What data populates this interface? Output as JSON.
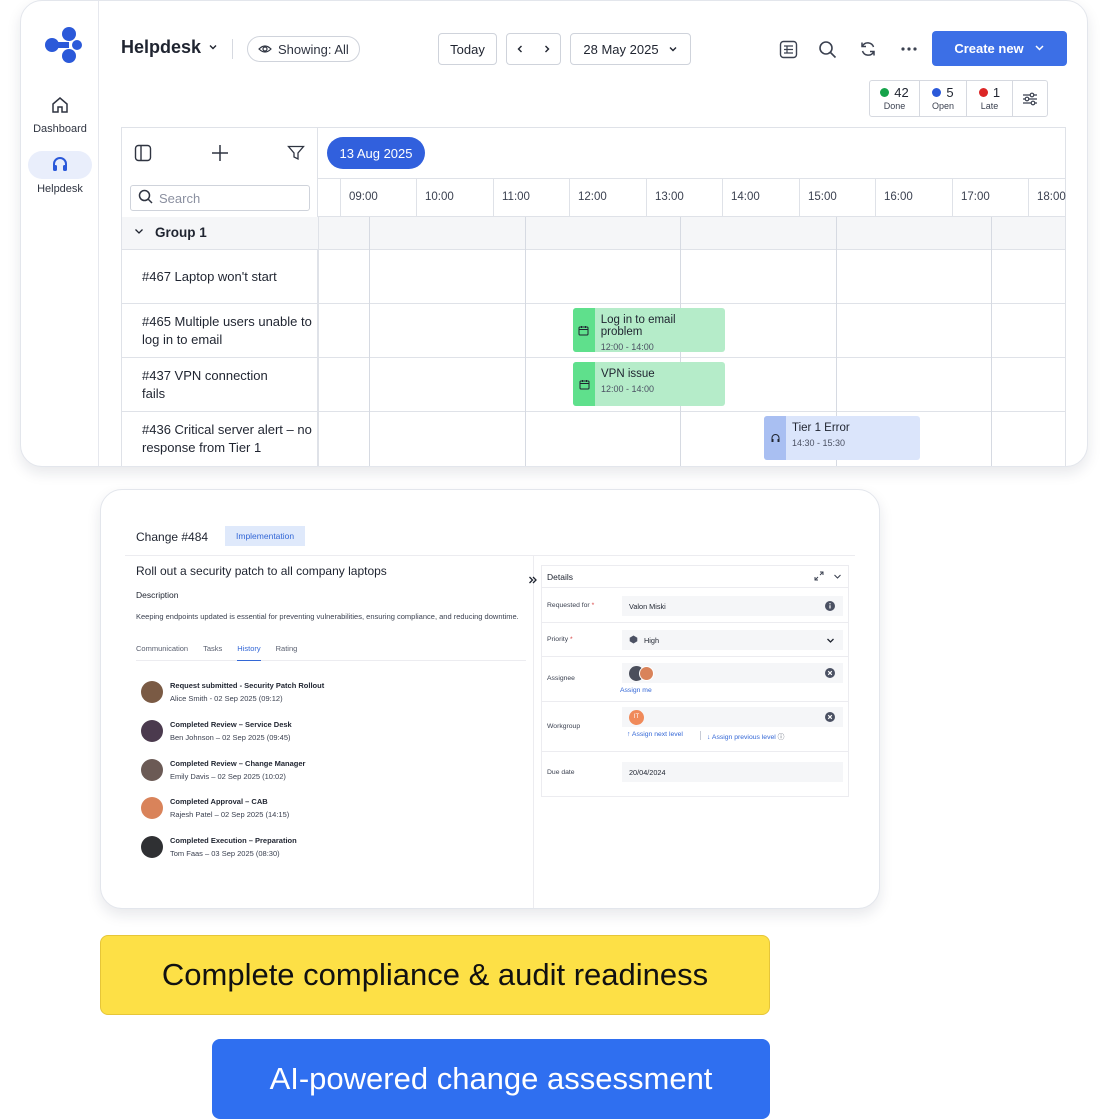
{
  "sidebar": {
    "items": [
      {
        "label": "Dashboard",
        "icon": "home-icon"
      },
      {
        "label": "Helpdesk",
        "icon": "headset-icon"
      }
    ]
  },
  "topbar": {
    "title": "Helpdesk",
    "showing": "Showing: All",
    "today": "Today",
    "date": "28 May 2025",
    "create": "Create new"
  },
  "stats": [
    {
      "value": "42",
      "label": "Done",
      "color": "#16a34a"
    },
    {
      "value": "5",
      "label": "Open",
      "color": "#2b59d9"
    },
    {
      "value": "1",
      "label": "Late",
      "color": "#dc2626"
    }
  ],
  "scheduler": {
    "date_bubble": "13 Aug 2025",
    "search_placeholder": "Search",
    "hours": [
      "09:00",
      "10:00",
      "11:00",
      "12:00",
      "13:00",
      "14:00",
      "15:00",
      "16:00",
      "17:00",
      "18:00"
    ],
    "group": "Group 1",
    "rows": [
      {
        "label": "#467 Laptop won't start"
      },
      {
        "label": "#465 Multiple users unable to log in to email"
      },
      {
        "label": "#437 VPN connection fails"
      },
      {
        "label": "#436 Critical server alert – no response from Tier 1"
      }
    ],
    "events": [
      {
        "title": "Log in to email problem",
        "time": "12:00 - 14:00"
      },
      {
        "title": "VPN issue",
        "time": "12:00 - 14:00"
      },
      {
        "title": "Tier 1 Error",
        "time": "14:30 - 15:30"
      }
    ]
  },
  "change": {
    "title": "Change #484",
    "badge": "Implementation",
    "summary": "Roll out a security patch to all company laptops",
    "description_label": "Description",
    "description": "Keeping endpoints updated is essential for preventing vulnerabilities, ensuring compliance, and reducing downtime.",
    "tabs": [
      "Communication",
      "Tasks",
      "History",
      "Rating"
    ],
    "history": [
      {
        "title": "Request submitted - Security Patch Rollout",
        "meta": "Alice Smith - 02 Sep 2025 (09:12)",
        "avatar": "#7a5a44"
      },
      {
        "title": "Completed Review – Service Desk",
        "meta": "Ben Johnson – 02 Sep 2025 (09:45)",
        "avatar": "#4b3a4e"
      },
      {
        "title": "Completed Review – Change Manager",
        "meta": "Emily Davis – 02 Sep 2025 (10:02)",
        "avatar": "#6b5a55"
      },
      {
        "title": "Completed Approval – CAB",
        "meta": "Rajesh Patel – 02 Sep 2025 (14:15)",
        "avatar": "#d9835a"
      },
      {
        "title": "Completed Execution – Preparation",
        "meta": "Tom Faas – 03 Sep 2025 (08:30)",
        "avatar": "#2f3033"
      }
    ],
    "details": {
      "header": "Details",
      "requested_for_label": "Requested for",
      "requested_for": "Valon Miski",
      "priority_label": "Priority",
      "priority": "High",
      "assignee_label": "Assignee",
      "assign_me": "Assign me",
      "workgroup_label": "Workgroup",
      "workgroup_avatar": "IT",
      "assign_next": "Assign next level",
      "assign_prev": "Assign previous level",
      "due_label": "Due date",
      "due": "20/04/2024"
    }
  },
  "banners": {
    "compliance": "Complete compliance & audit readiness",
    "ai": "AI-powered change assessment"
  },
  "colors": {
    "accent": "#3c6fe6",
    "banner_yellow": "#fde046",
    "banner_blue": "#2f6ff0"
  }
}
